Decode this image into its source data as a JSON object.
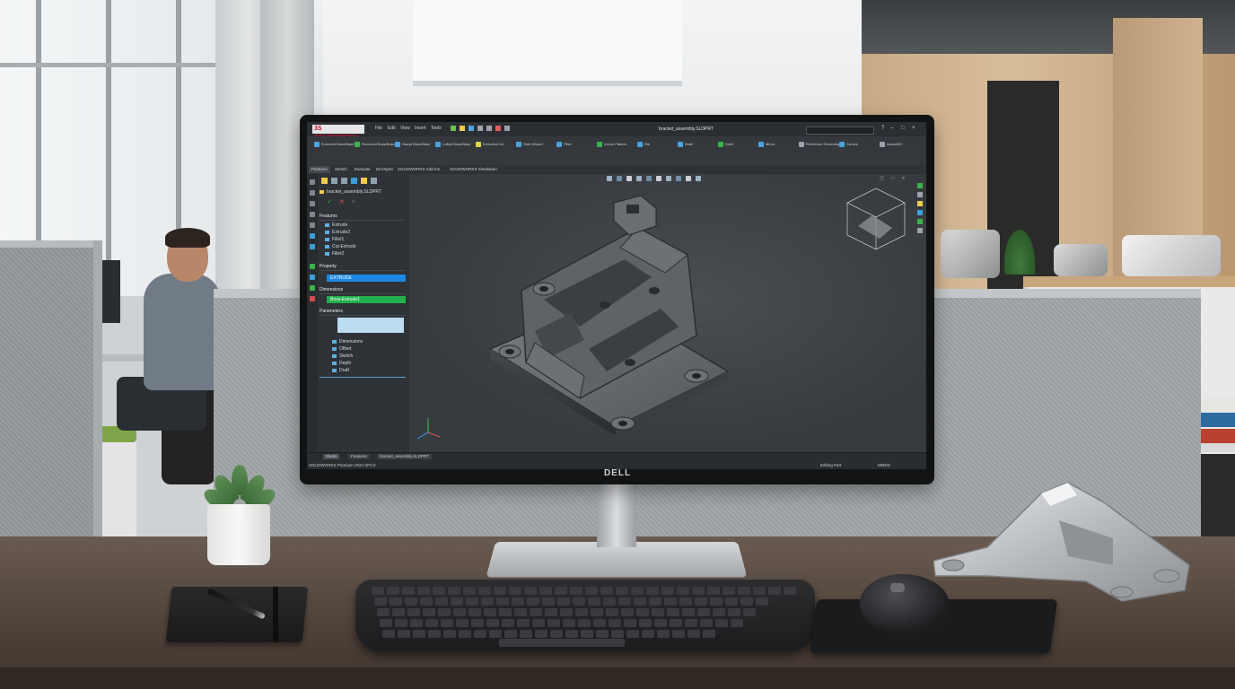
{
  "scene": {
    "monitor_brand": "DELL"
  },
  "app": {
    "logo": "3S SOLIDWORKS",
    "title": "bracket_assembly.SLDPRT",
    "menu": [
      "File",
      "Edit",
      "View",
      "Insert",
      "Tools"
    ],
    "ribbon_groups": [
      {
        "label": "Extruded Boss/Base"
      },
      {
        "label": "Revolved Boss/Base"
      },
      {
        "label": "Swept Boss/Base"
      },
      {
        "label": "Lofted Boss/Base"
      },
      {
        "label": "Extruded Cut"
      },
      {
        "label": "Hole Wizard"
      },
      {
        "label": "Fillet"
      },
      {
        "label": "Linear Pattern"
      },
      {
        "label": "Rib"
      },
      {
        "label": "Draft"
      },
      {
        "label": "Shell"
      },
      {
        "label": "Mirror"
      },
      {
        "label": "Reference Geometry"
      },
      {
        "label": "Curves"
      },
      {
        "label": "Instant3D"
      }
    ],
    "command_tabs": [
      "Features",
      "Sketch",
      "Evaluate",
      "DimXpert",
      "SOLIDWORKS Add-Ins",
      "SOLIDWORKS Simulation"
    ],
    "feature_tree": {
      "part_name": "bracket_assembly.SLDPRT",
      "sections": {
        "features": "Features",
        "features_items": [
          "Extrude",
          "Extrude2",
          "Fillet1",
          "Cut-Extrude",
          "Fillet2"
        ],
        "property": "Property",
        "property_value": "EXTRUDE",
        "dimensions": "Dimensions",
        "dimensions_value": "Boss-Extrude1",
        "parameters": "Parameters",
        "param_items": [
          "Dimensions",
          "Offset",
          "Sketch",
          "Depth",
          "Draft"
        ]
      }
    },
    "heads_up_icons": [
      "zoom-fit-icon",
      "zoom-area-icon",
      "rotate-icon",
      "section-view-icon",
      "view-orientation-icon",
      "display-style-icon",
      "hide-show-icon",
      "appearance-icon",
      "scene-icon",
      "view-settings-icon"
    ],
    "status": {
      "tabs": [
        "Model",
        "Features",
        "bracket_assembly.SLDPRT"
      ],
      "left_text": "SOLIDWORKS Premium 2024 SP2.0",
      "right_text": "Editing Part",
      "units": "MMGS"
    }
  },
  "colors": {
    "accent_red": "#c8102e",
    "field_blue": "#1e88e5",
    "field_green": "#22b14c",
    "viewport_bg": "#3b3f44"
  }
}
